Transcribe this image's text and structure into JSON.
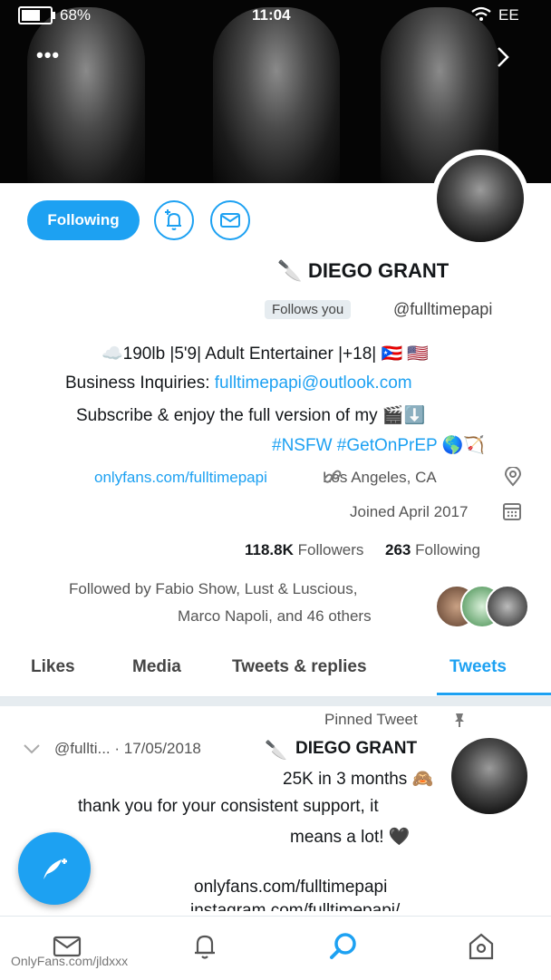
{
  "status_bar": {
    "battery": "68%",
    "battery_level": 0.68,
    "time": "11:04",
    "carrier": "EE"
  },
  "profile": {
    "following_button": "Following",
    "name": "DIEGO GRANT",
    "name_emoji": "🔪",
    "handle": "@fulltimepapi",
    "follows_you": "Follows you",
    "bio_line1": "☁️190lb |5'9| Adult Entertainer |+18| 🇵🇷 🇺🇸",
    "bio_line2_prefix": "Business Inquiries: ",
    "bio_line2_email": "fulltimepapi@outlook.com",
    "bio_line3": "Subscribe & enjoy the full version of my 🎬⬇️",
    "bio_line4_tags": "#NSFW #GetOnPrEP",
    "bio_line4_emoji": "🌎🏹",
    "location": "Los Angeles, CA",
    "website": "onlyfans.com/fulltimepapi",
    "joined": "Joined April 2017",
    "following_count": "263",
    "following_label": "Following",
    "followers_count": "118.8K",
    "followers_label": "Followers",
    "followed_by_line1": "Followed by Fabio Show, Lust & Luscious,",
    "followed_by_line2": "Marco Napoli, and 46 others"
  },
  "tabs": [
    "Tweets",
    "Tweets & replies",
    "Media",
    "Likes"
  ],
  "active_tab": "Tweets",
  "tweet": {
    "pinned_label": "Pinned Tweet",
    "author": "DIEGO GRANT",
    "author_emoji": "🔪",
    "meta": "@fullti... · 17/05/2018",
    "line1": "25K in 3 months 🙈",
    "line2": "thank you for your consistent support, it",
    "line3": "means a lot! 🖤",
    "link1": "onlyfans.com/fulltimepapi",
    "link2": "instagram.com/fulltimepapi/"
  },
  "watermark": "OnlyFans.com/jldxxx",
  "colors": {
    "accent": "#1da1f2",
    "text": "#14171a",
    "muted": "#657786"
  },
  "icons": {
    "mail": "mail-icon",
    "notify": "bell-plus-icon",
    "location": "location-pin-icon",
    "link": "link-icon",
    "calendar": "calendar-icon",
    "pin": "pin-icon",
    "compose": "compose-icon"
  }
}
